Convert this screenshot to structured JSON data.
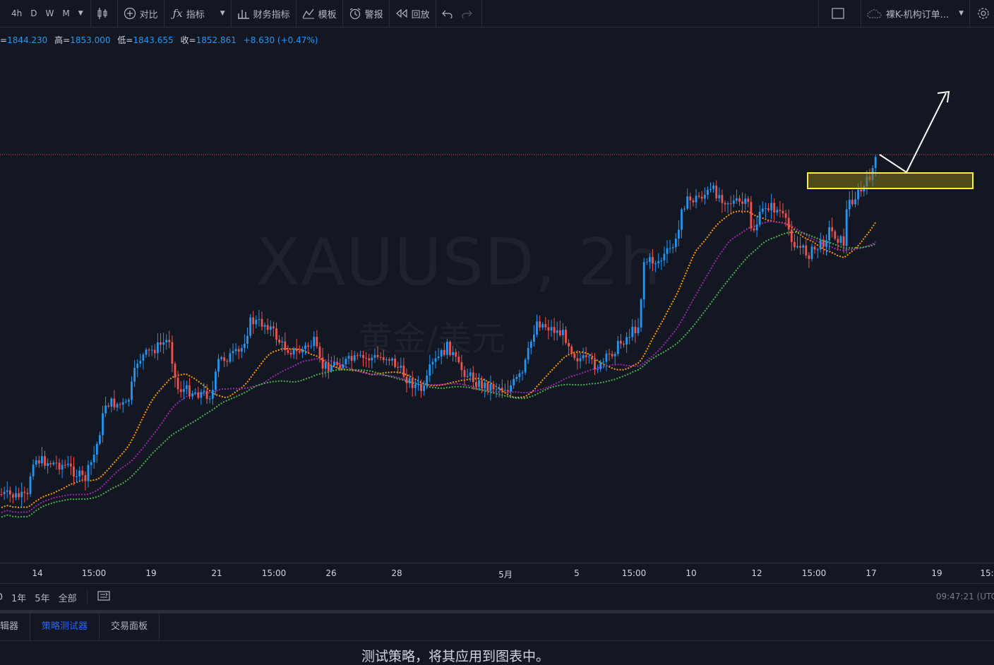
{
  "toolbar": {
    "timeframes": [
      "4h",
      "D",
      "W",
      "M"
    ],
    "compare_label": "对比",
    "indicators_label": "指标",
    "financials_label": "财务指标",
    "templates_label": "模板",
    "alert_label": "警报",
    "replay_label": "回放",
    "layout_name": "裸K-机构订单..."
  },
  "ohlc": {
    "open_value": "1844.230",
    "high_label": "高",
    "high_value": "1853.000",
    "low_label": "低",
    "low_value": "1843.655",
    "close_label": "收",
    "close_value": "1852.861",
    "change": "+8.630 (+0.47%)"
  },
  "watermark": {
    "symbol": "XAUUSD, 2h",
    "description": "黄金/美元"
  },
  "time_axis": [
    "14",
    "15:00",
    "19",
    "21",
    "15:00",
    "26",
    "28",
    "5月",
    "5",
    "15:00",
    "10",
    "12",
    "15:00",
    "17",
    "19",
    "15:"
  ],
  "ranges": [
    "D",
    "1年",
    "5年",
    "全部"
  ],
  "clock": "09:47:21 (UTC",
  "bottom_tabs": [
    "辑器",
    "策略测试器",
    "交易面板"
  ],
  "active_tab": "策略测试器",
  "panel_message": "测试策略，将其应用到图表中。",
  "colors": {
    "up": "#2196f3",
    "down": "#ef5350",
    "ma1": "#ff9800",
    "ma2": "#9c27b0",
    "ma3": "#4caf50",
    "zone": "#ffeb3b"
  }
}
